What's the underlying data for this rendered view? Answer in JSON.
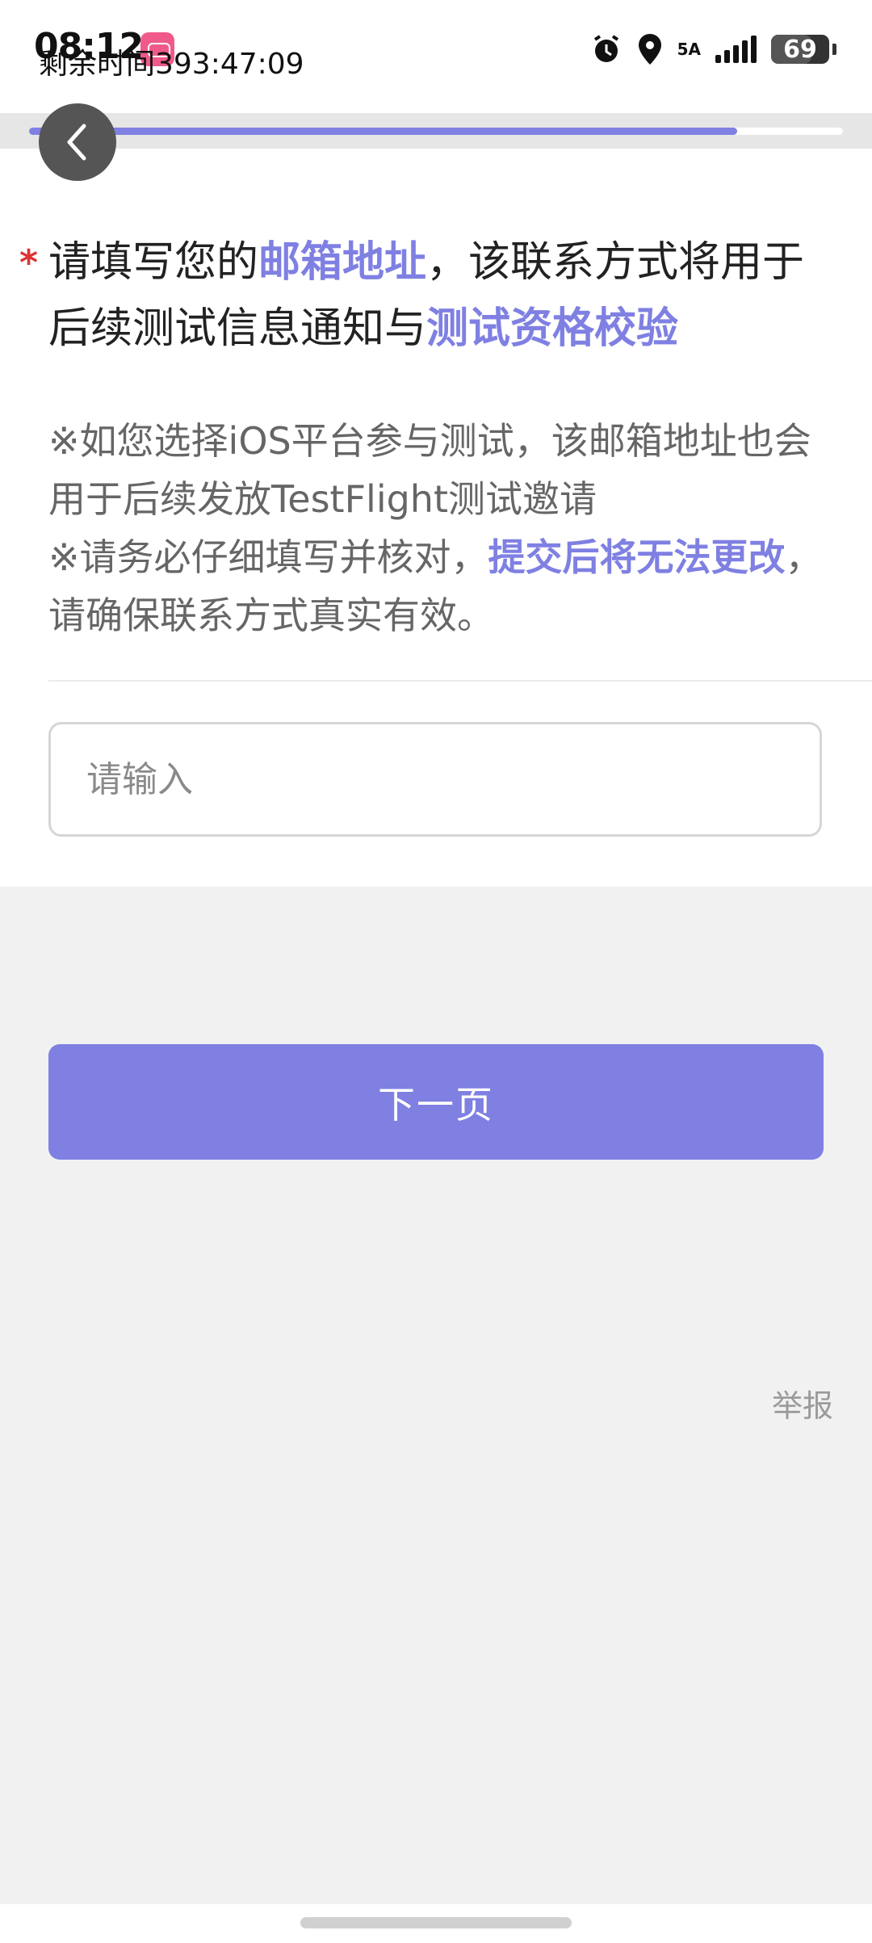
{
  "status_bar": {
    "time": "08:12",
    "remaining_time": "剩余时间393:47:09",
    "network": "5A",
    "battery": "69",
    "battery_level": 0.69
  },
  "progress": {
    "fraction": 0.87
  },
  "question": {
    "text_1": "请填写您的",
    "highlight_1": "邮箱地址",
    "text_2": "，该联系方式将用于后续测试信息通知与",
    "highlight_2": "测试资格校验"
  },
  "notes": {
    "line_1": "※如您选择iOS平台参与测试，该邮箱地址也会用于后续发放TestFlight测试邀请",
    "line_2_text": "※请务必仔细填写并核对，",
    "line_2_highlight": "提交后将无法更改",
    "line_2_end": "，请确保联系方式真实有效。"
  },
  "input": {
    "placeholder": "请输入",
    "value": ""
  },
  "buttons": {
    "next": "下一页",
    "report": "举报"
  },
  "colors": {
    "accent": "#7f80e2",
    "required": "#dd3333",
    "page_bg": "#f1f1f1"
  }
}
